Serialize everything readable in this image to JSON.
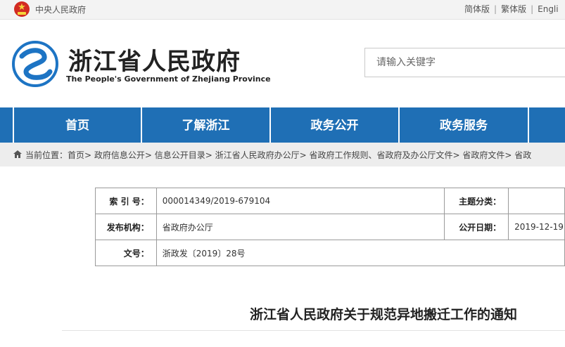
{
  "topbar": {
    "central_gov": "中央人民政府",
    "langs": [
      "简体版",
      "繁体版",
      "Engli"
    ]
  },
  "header": {
    "title": "浙江省人民政府",
    "subtitle": "The People's Government of Zhejiang Province",
    "logo_icon": "zhejiang-wave-logo"
  },
  "search": {
    "placeholder": "请输入关键字"
  },
  "nav": {
    "items": [
      "首页",
      "了解浙江",
      "政务公开",
      "政务服务"
    ]
  },
  "breadcrumb": {
    "text": "当前位置：首页> 政府信息公开> 信息公开目录> 浙江省人民政府办公厅> 省政府工作规则、省政府及办公厅文件> 省政府文件> 省政"
  },
  "meta": {
    "index_label": "索 引 号：",
    "index_value": "000014349/2019-679104",
    "topic_label": "主题分类：",
    "topic_value": "",
    "issuer_label": "发布机构：",
    "issuer_value": "省政府办公厅",
    "date_label": "公开日期：",
    "date_value": "2019-12-19",
    "docno_label": "文号：",
    "docno_value": "浙政发〔2019〕28号"
  },
  "document": {
    "title": "浙江省人民政府关于规范异地搬迁工作的通知"
  },
  "colors": {
    "nav_blue": "#1f6fb5",
    "logo_blue": "#1d74c4",
    "emblem_red": "#d22b22"
  }
}
